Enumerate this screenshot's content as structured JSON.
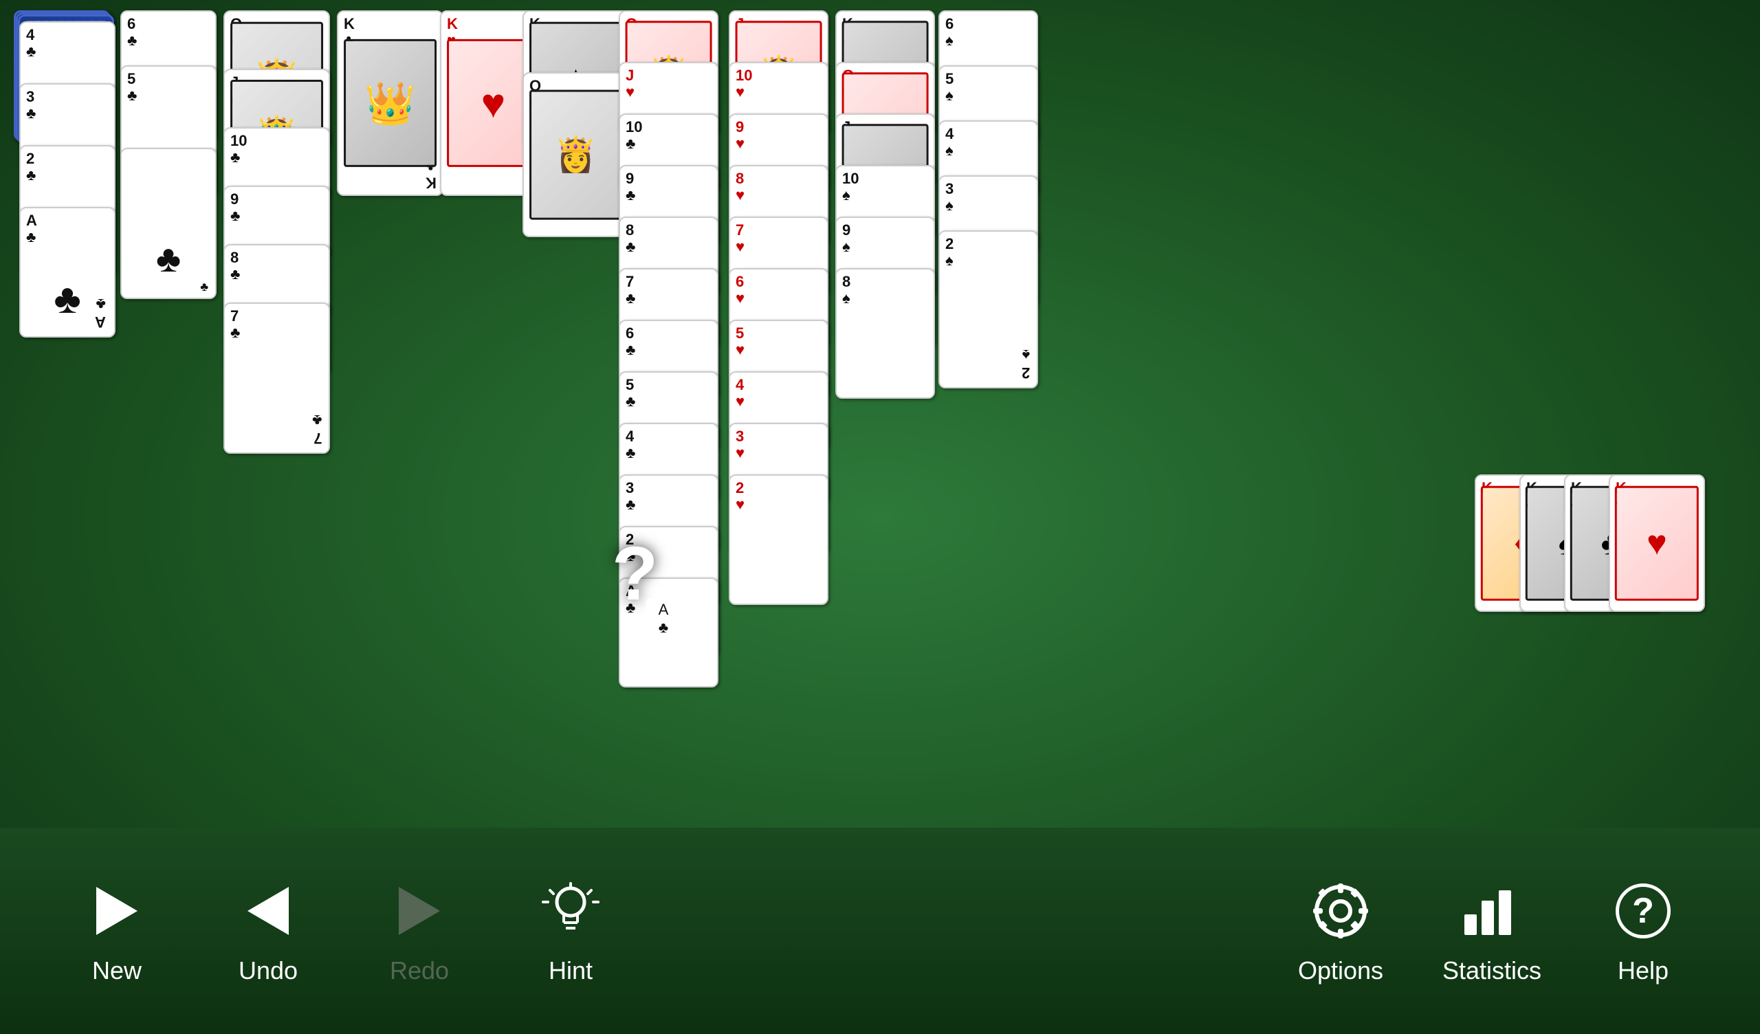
{
  "toolbar": {
    "buttons": [
      {
        "id": "new",
        "label": "New",
        "icon": "play-icon",
        "dimmed": false
      },
      {
        "id": "undo",
        "label": "Undo",
        "icon": "undo-icon",
        "dimmed": false
      },
      {
        "id": "redo",
        "label": "Redo",
        "icon": "redo-icon",
        "dimmed": true
      },
      {
        "id": "hint",
        "label": "Hint",
        "icon": "hint-icon",
        "dimmed": false
      },
      {
        "id": "options",
        "label": "Options",
        "icon": "options-icon",
        "dimmed": false
      },
      {
        "id": "statistics",
        "label": "Statistics",
        "icon": "statistics-icon",
        "dimmed": false
      },
      {
        "id": "help",
        "label": "Help",
        "icon": "help-icon",
        "dimmed": false
      }
    ]
  },
  "columns": {
    "col1_cards": [
      "4♣",
      "3♣",
      "2♣",
      "A♣"
    ],
    "col2_cards": [
      "6♣",
      "5♣",
      "(clubs)"
    ],
    "col3_cards": [
      "Q♣",
      "J♣",
      "10♣",
      "9♣",
      "8♣",
      "7♣"
    ],
    "col4_cards": [
      "K♣"
    ],
    "col5_cards": [
      "K♥"
    ],
    "col6_cards": [
      "K♠",
      "Q♠"
    ],
    "col7_cards": [
      "Q♥",
      "J♥",
      "10♣",
      "9♣",
      "8♣",
      "7♣",
      "6♣",
      "5♣",
      "4♣",
      "3♣",
      "2♣",
      "A♣"
    ],
    "col8_cards": [
      "J♥",
      "10♥",
      "9♥",
      "8♥",
      "7♥",
      "6♥",
      "5♥",
      "4♥",
      "3♥",
      "2♥"
    ],
    "col9_cards": [
      "K♣",
      "Q♥",
      "J♠",
      "10♠",
      "9♠",
      "8♠"
    ],
    "col10_cards": [
      "6♠",
      "5♠",
      "4♠",
      "3♠",
      "2♠"
    ]
  }
}
